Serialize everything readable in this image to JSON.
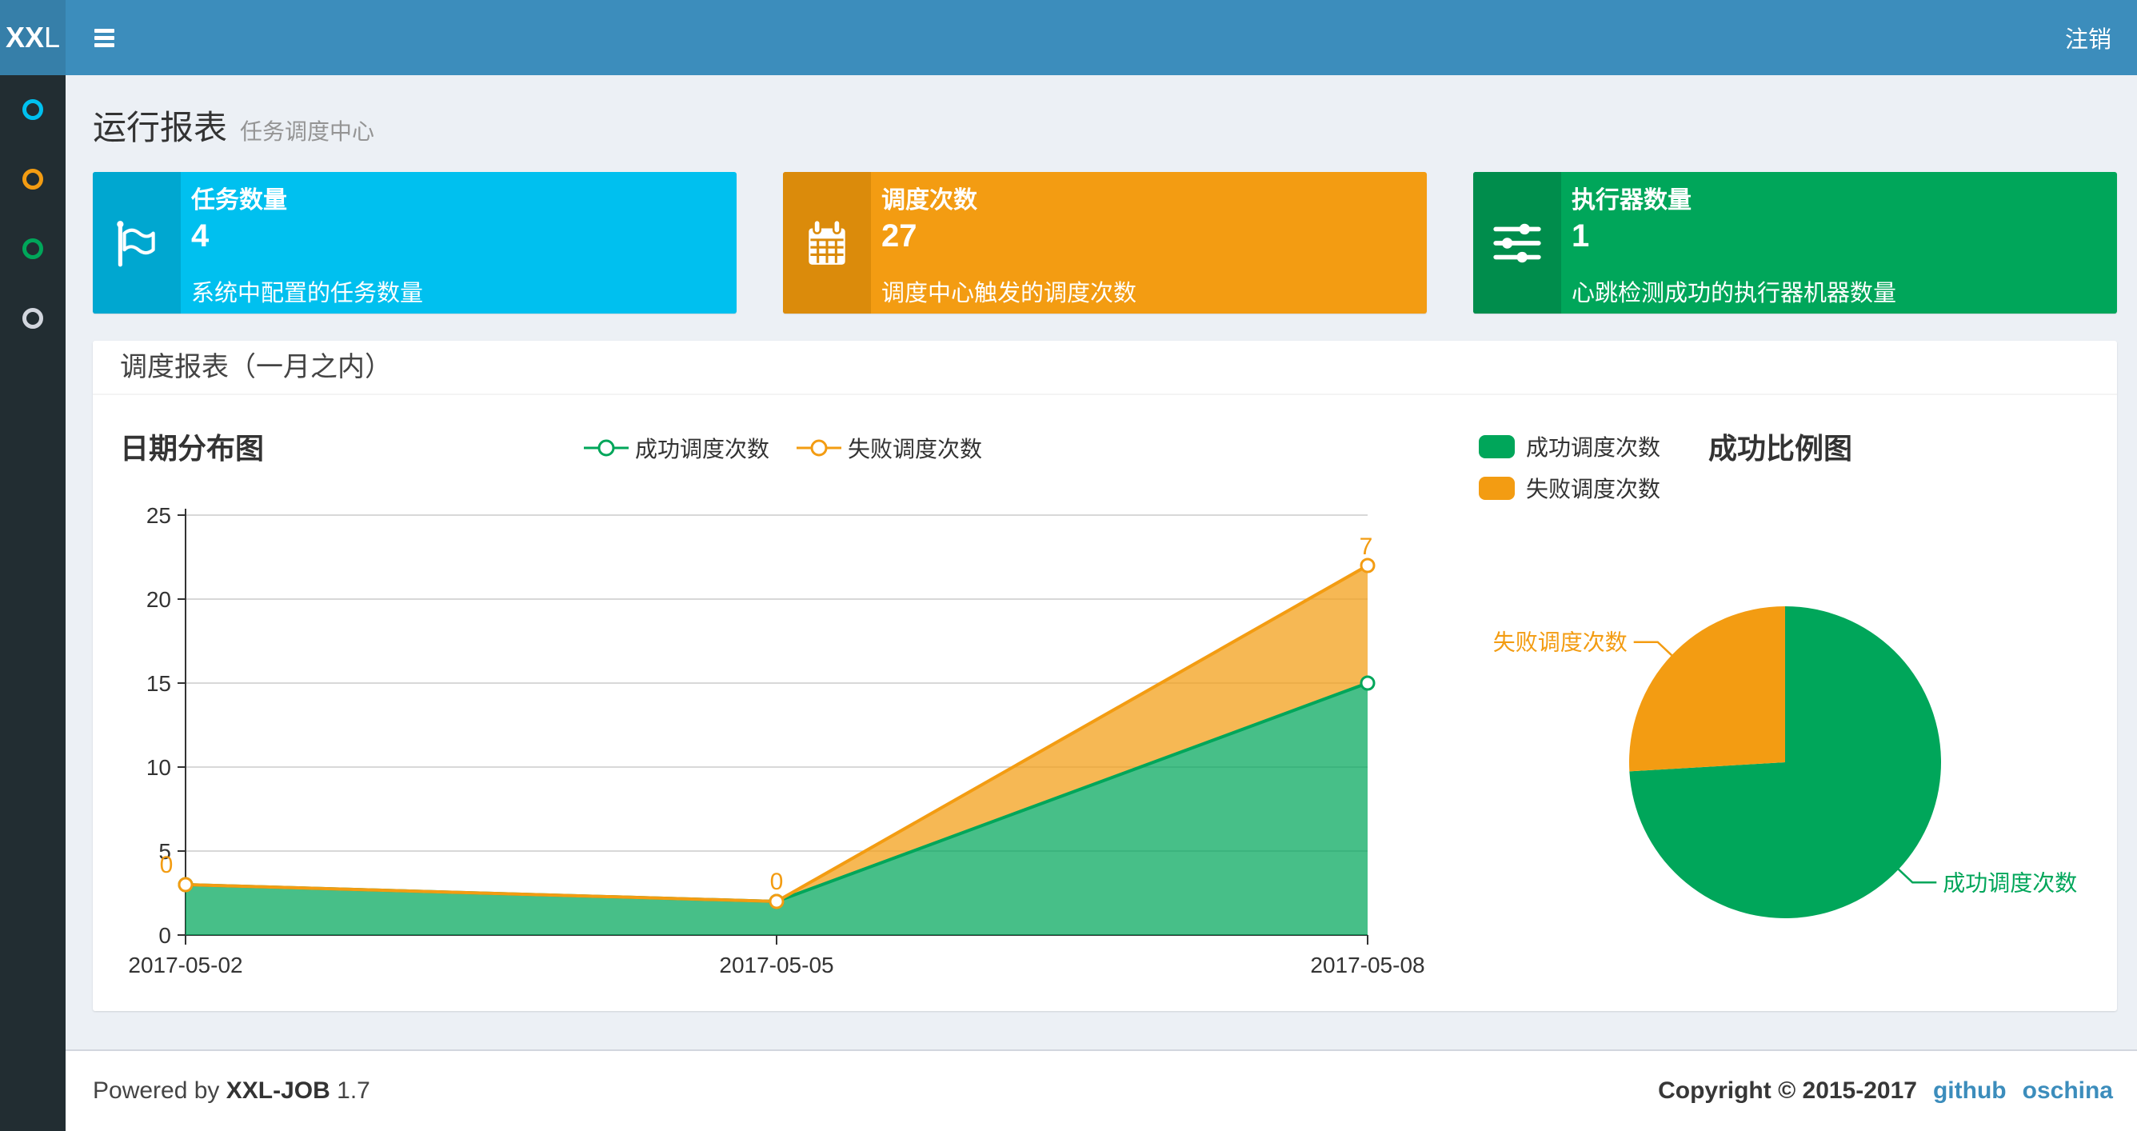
{
  "navbar": {
    "logo_bold": "XX",
    "logo_rest": "L",
    "logout_label": "注销"
  },
  "sidebar": {
    "items": [
      {
        "color": "#00c0ef"
      },
      {
        "color": "#f39c12"
      },
      {
        "color": "#00a65a"
      },
      {
        "color": "#d2d6de"
      }
    ]
  },
  "page_header": {
    "title": "运行报表",
    "subtitle": "任务调度中心"
  },
  "stat_cards": [
    {
      "title": "任务数量",
      "value": "4",
      "desc": "系统中配置的任务数量",
      "bg": "#00c0ef",
      "icon_bg": "#00a7d0",
      "icon": "flag-icon"
    },
    {
      "title": "调度次数",
      "value": "27",
      "desc": "调度中心触发的调度次数",
      "bg": "#f39c12",
      "icon_bg": "#db8b0b",
      "icon": "calendar-icon"
    },
    {
      "title": "执行器数量",
      "value": "1",
      "desc": "心跳检测成功的执行器机器数量",
      "bg": "#00a65a",
      "icon_bg": "#008d4c",
      "icon": "sliders-icon"
    }
  ],
  "panel": {
    "title": "调度报表（一月之内）"
  },
  "footer": {
    "powered_by": "Powered by",
    "brand": "XXL-JOB",
    "version": "1.7",
    "copyright": "Copyright © 2015-2017",
    "links": [
      {
        "label": "github"
      },
      {
        "label": "oschina"
      }
    ],
    "link_color": "#3c8dbc"
  },
  "chart_data": [
    {
      "type": "area",
      "title": "日期分布图",
      "x": [
        "2017-05-02",
        "2017-05-05",
        "2017-05-08"
      ],
      "series": [
        {
          "name": "成功调度次数",
          "values": [
            3,
            2,
            15
          ],
          "color": "#00a65a"
        },
        {
          "name": "失败调度次数",
          "values": [
            0,
            0,
            7
          ],
          "color": "#f39c12",
          "point_labels": [
            "0",
            "0",
            "7"
          ]
        }
      ],
      "stacked": true,
      "xlabel": "",
      "ylabel": "",
      "ylim": [
        0,
        25
      ],
      "ytick_step": 5,
      "grid": true,
      "legend_position": "top-center"
    },
    {
      "type": "pie",
      "title": "成功比例图",
      "slices": [
        {
          "label": "成功调度次数",
          "value": 20,
          "color": "#00a65a"
        },
        {
          "label": "失败调度次数",
          "value": 7,
          "color": "#f39c12"
        }
      ],
      "legend_position": "top-left"
    }
  ]
}
